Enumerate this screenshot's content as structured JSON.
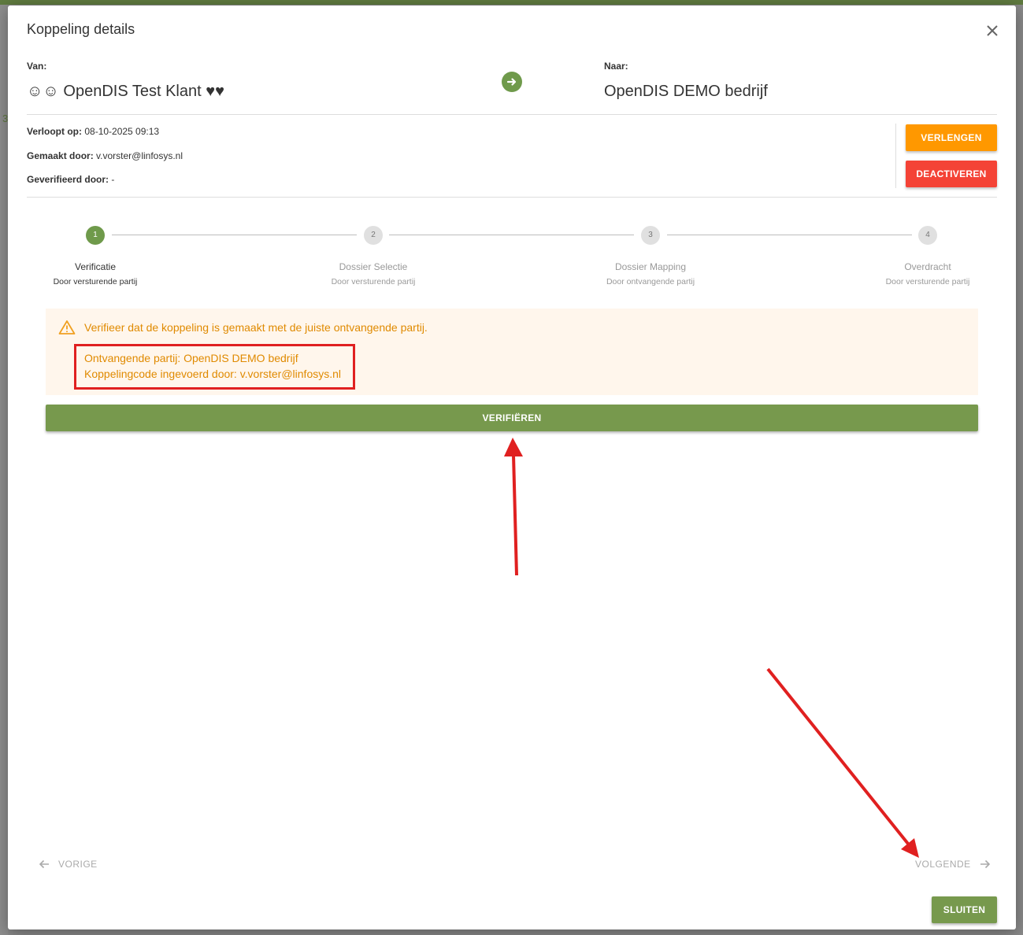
{
  "dialog": {
    "title": "Koppeling details",
    "close_icon": "close-icon"
  },
  "parties": {
    "van_label": "Van:",
    "van_value": "☺☺ OpenDIS Test Klant ♥♥",
    "naar_label": "Naar:",
    "naar_value": "OpenDIS DEMO bedrijf",
    "arrow_icon": "arrow-right-icon"
  },
  "meta": {
    "verloopt_label": "Verloopt op:",
    "verloopt_value": "08-10-2025 09:13",
    "gemaakt_label": "Gemaakt door:",
    "gemaakt_value": "v.vorster@linfosys.nl",
    "geverifieerd_label": "Geverifieerd door:",
    "geverifieerd_value": "-"
  },
  "actions": {
    "verlengen": "VERLENGEN",
    "deactiveren": "DEACTIVEREN"
  },
  "steps": [
    {
      "number": "1",
      "title": "Verificatie",
      "subtitle": "Door versturende partij",
      "active": true
    },
    {
      "number": "2",
      "title": "Dossier Selectie",
      "subtitle": "Door versturende partij",
      "active": false
    },
    {
      "number": "3",
      "title": "Dossier Mapping",
      "subtitle": "Door ontvangende partij",
      "active": false
    },
    {
      "number": "4",
      "title": "Overdracht",
      "subtitle": "Door versturende partij",
      "active": false
    }
  ],
  "warning": {
    "icon": "warning-triangle-icon",
    "message": "Verifieer dat de koppeling is gemaakt met de juiste ontvangende partij.",
    "line1": "Ontvangende partij: OpenDIS DEMO bedrijf",
    "line2": "Koppelingcode ingevoerd door: v.vorster@linfosys.nl"
  },
  "verify_button": "VERIFIËREN",
  "navigation": {
    "previous": "VORIGE",
    "next": "VOLGENDE"
  },
  "close_button": "SLUITEN",
  "colors": {
    "primary_green": "#77994d",
    "orange": "#ff9800",
    "red": "#f44336",
    "warning_text": "#e08a00",
    "warning_bg": "#fff6ec",
    "annotation_red": "#e02020"
  },
  "background_stray_char": "3"
}
